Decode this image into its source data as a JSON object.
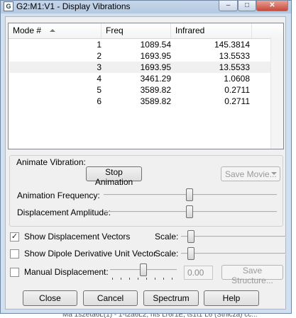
{
  "window": {
    "title": "G2:M1:V1 - Display Vibrations",
    "app_icon": "G",
    "minimize_icon": "–",
    "maximize_icon": "□",
    "close_icon": "✕"
  },
  "table": {
    "columns": [
      "Mode #",
      "Freq",
      "Infrared"
    ],
    "rows": [
      {
        "mode": "1",
        "freq": "1089.54",
        "ir": "145.3814"
      },
      {
        "mode": "2",
        "freq": "1693.95",
        "ir": "13.5533"
      },
      {
        "mode": "3",
        "freq": "1693.95",
        "ir": "13.5533"
      },
      {
        "mode": "4",
        "freq": "3461.29",
        "ir": "1.0608"
      },
      {
        "mode": "5",
        "freq": "3589.82",
        "ir": "0.2711"
      },
      {
        "mode": "6",
        "freq": "3589.82",
        "ir": "0.2711"
      }
    ],
    "selected_row": 3
  },
  "animate": {
    "group_label": "Animate Vibration:",
    "stop_button": "Stop Animation",
    "save_movie_button": "Save Movie...",
    "frequency_label": "Animation Frequency:",
    "frequency_level": 0.5,
    "amplitude_label": "Displacement Amplitude:",
    "amplitude_level": 0.5
  },
  "options": {
    "show_vectors_label": "Show Displacement Vectors",
    "show_vectors_checked": true,
    "show_dipole_label": "Show Dipole Derivative Unit Vector",
    "show_dipole_checked": false,
    "scale_label": "Scale:",
    "manual_label": "Manual Displacement:",
    "manual_checked": false,
    "manual_value": "0.00",
    "save_structure_button": "Save Structure..."
  },
  "buttons": {
    "close": "Close",
    "cancel": "Cancel",
    "spectrum": "Spectrum",
    "help": "Help"
  },
  "background_text": "Ma 1s2eta6L(1) - 1-t2a6L2, nts Lr6r1E, ts1t1 L6 (Sthicza) cc..."
}
